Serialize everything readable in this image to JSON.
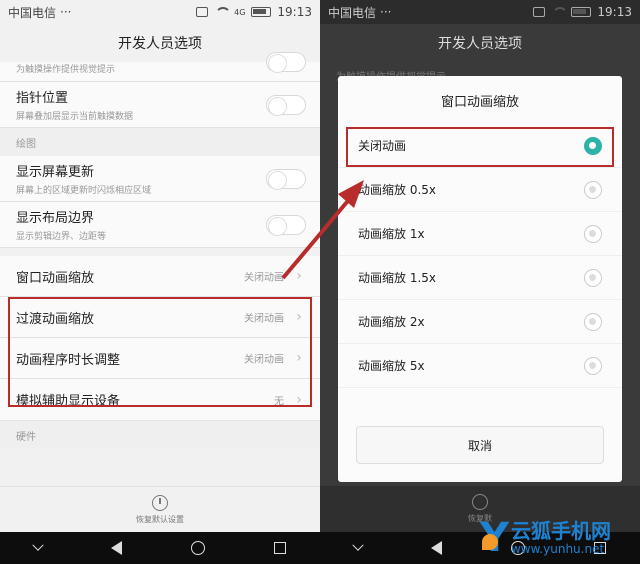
{
  "left": {
    "status": {
      "carrier": "中国电信",
      "dots": "···",
      "time": "19:13",
      "net": "4G"
    },
    "title": "开发人员选项",
    "top_partial_subtitle": "为触摸操作提供视觉提示",
    "pointer": {
      "title": "指针位置",
      "subtitle": "屏幕叠加层显示当前触摸数据"
    },
    "section_drawing": "绘图",
    "show_updates": {
      "title": "显示屏幕更新",
      "subtitle": "屏幕上的区域更新时闪烁相应区域"
    },
    "show_layout": {
      "title": "显示布局边界",
      "subtitle": "显示剪辑边界、边距等"
    },
    "window_anim": {
      "title": "窗口动画缩放",
      "value": "关闭动画"
    },
    "transition_anim": {
      "title": "过渡动画缩放",
      "value": "关闭动画"
    },
    "animator_duration": {
      "title": "动画程序时长调整",
      "value": "关闭动画"
    },
    "simulate_display": {
      "title": "模拟辅助显示设备",
      "value": "无"
    },
    "section_hardware": "硬件",
    "restore_label": "恢复默认设置"
  },
  "right": {
    "status": {
      "carrier": "中国电信",
      "dots": "···",
      "time": "19:13"
    },
    "title": "开发人员选项",
    "bg_ghost": "为触摸操作提供视觉提示",
    "dialog": {
      "title": "窗口动画缩放",
      "options": [
        {
          "label": "关闭动画",
          "selected": true
        },
        {
          "label": "动画缩放 0.5x",
          "selected": false
        },
        {
          "label": "动画缩放 1x",
          "selected": false
        },
        {
          "label": "动画缩放 1.5x",
          "selected": false
        },
        {
          "label": "动画缩放 2x",
          "selected": false
        },
        {
          "label": "动画缩放 5x",
          "selected": false
        }
      ],
      "cancel": "取消"
    },
    "restore_label": "恢复默"
  },
  "watermark": {
    "letter": "Y",
    "name": "云狐手机网",
    "url": "www.yunhu.net"
  },
  "colors": {
    "highlight": "#b82c2c",
    "accent": "#2ab3a6",
    "arrow": "#b82c2c",
    "brand": "#1e82d2"
  }
}
